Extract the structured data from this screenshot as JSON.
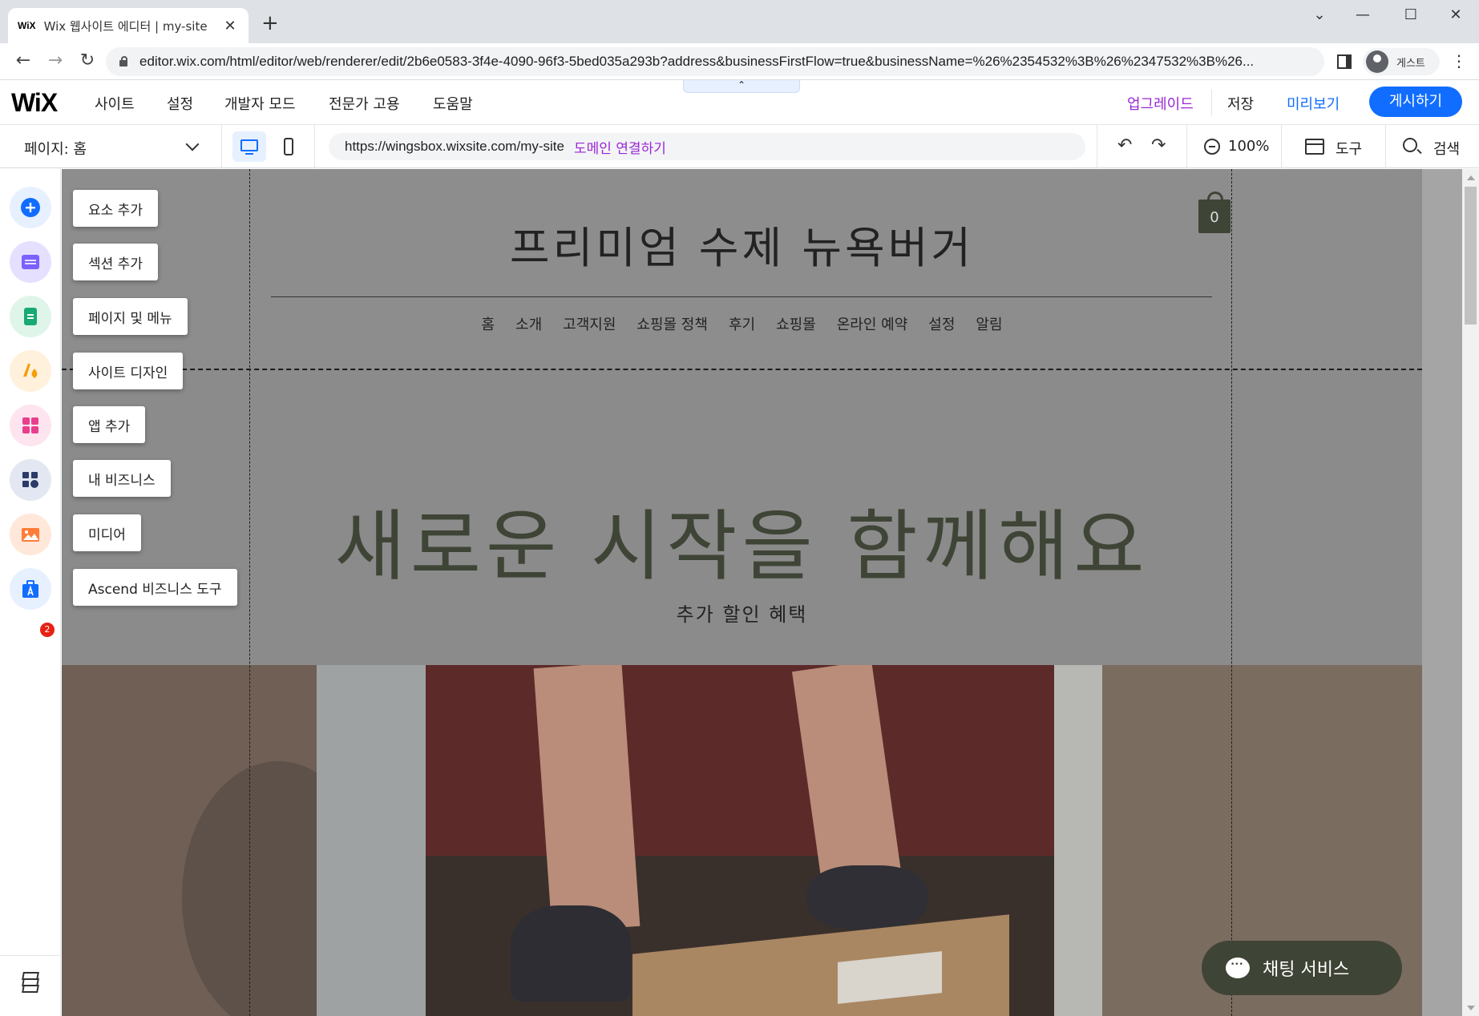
{
  "browser": {
    "tab_title": "Wix 웹사이트 에디터 | my-site",
    "tab_favicon": "WiX",
    "url": "editor.wix.com/html/editor/web/renderer/edit/2b6e0583-3f4e-4090-96f3-5bed035a293b?address&businessFirstFlow=true&businessName=%26%2354532%3B%26%2347532%3B%26...",
    "profile_label": "게스트"
  },
  "wix_top": {
    "logo": "WiX",
    "menu": [
      "사이트",
      "설정",
      "개발자 모드",
      "전문가 고용",
      "도움말"
    ],
    "upgrade": "업그레이드",
    "save": "저장",
    "preview": "미리보기",
    "publish": "게시하기"
  },
  "wix_toolbar": {
    "page_selector": "페이지: 홈",
    "site_url": "https://wingsbox.wixsite.com/my-site",
    "connect_domain": "도메인 연결하기",
    "zoom": "100%",
    "tools": "도구",
    "search": "검색"
  },
  "left_rail": {
    "icons": [
      "add-element-icon",
      "add-section-icon",
      "pages-menu-icon",
      "site-design-icon",
      "add-apps-icon",
      "my-business-icon",
      "media-icon",
      "ascend-icon",
      "layers-icon"
    ],
    "colors": [
      "#116dff",
      "#7b61ff",
      "#18a974",
      "#f59e0b",
      "#e83e8c",
      "#2b3a67",
      "#ff7d38",
      "#116dff"
    ],
    "business_badge": "2",
    "labels": [
      "요소 추가",
      "섹션 추가",
      "페이지 및 메뉴",
      "사이트 디자인",
      "앱 추가",
      "내 비즈니스",
      "미디어",
      "Ascend 비즈니스 도구"
    ]
  },
  "site": {
    "title": "프리미엄 수제 뉴욕버거",
    "nav": [
      "홈",
      "소개",
      "고객지원",
      "쇼핑몰 정책",
      "후기",
      "쇼핑몰",
      "온라인 예약",
      "설정",
      "알림"
    ],
    "cart_count": "0",
    "hero_title": "새로운 시작을 함께해요",
    "hero_subtitle": "추가 할인 혜택",
    "chat_label": "채팅 서비스"
  }
}
